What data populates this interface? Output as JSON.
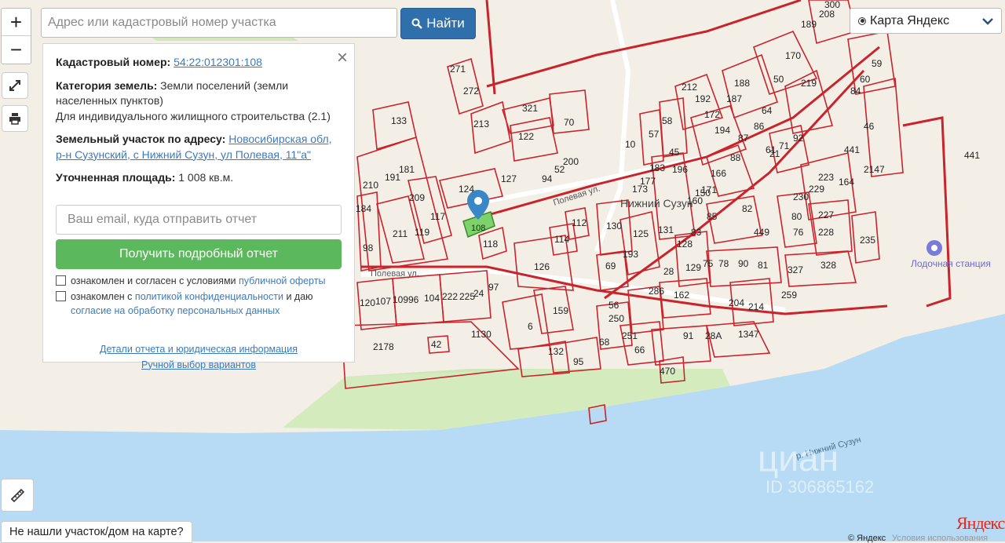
{
  "search": {
    "placeholder": "Адрес или кадастровый номер участка",
    "button_label": "Найти"
  },
  "layer_select": {
    "value": "Карта Яндекс"
  },
  "controls": {
    "zoom_in": "+",
    "zoom_out": "−"
  },
  "panel": {
    "cadastral_label": "Кадастровый номер:",
    "cadastral_number": "54:22:012301:108",
    "category_label": "Категория земель:",
    "category_value": "Земли поселений (земли населенных пунктов)",
    "use_value": "Для индивидуального жилищного строительства (2.1)",
    "address_label": "Земельный участок по адресу:",
    "address_value": "Новосибирская обл, р-н Сузунский, с Нижний Сузун, ул Полевая, 11\"а\"",
    "area_label": "Уточненная площадь:",
    "area_value": "1 008 кв.м.",
    "email_placeholder": "Ваш email, куда отправить отчет",
    "report_button": "Получить подробный отчет",
    "consent1_prefix": "ознакомлен и согласен с условиями",
    "consent1_link": "публичной оферты",
    "consent2_prefix": "ознакомлен с",
    "consent2_link": "политикой конфиденциальности",
    "consent2_mid": "и даю",
    "consent2_link2": "согласие на обработку персональных данных",
    "details_link": "Детали отчета и юридическая информация",
    "manual_link": "Ручной выбор вариантов"
  },
  "bottom": {
    "not_found": "Не нашли участок/дом на карте?",
    "yandex_logo": "Яндекс",
    "copyright": "© Яндекс",
    "terms": "Условия использования"
  },
  "map": {
    "street_1": "Полевая ул.",
    "street_2": "Полевая ул.",
    "village": "Нижний Сузун",
    "station": "Лодочная станция",
    "river": "р. Нижний Сузун",
    "watermark": "циан",
    "watermark_id": "ID 306865162",
    "selected_parcel": "108",
    "parcels": [
      "271",
      "272",
      "213",
      "133",
      "321",
      "122",
      "70",
      "181",
      "191",
      "210",
      "209",
      "124",
      "127",
      "117",
      "119",
      "211",
      "184",
      "98",
      "118",
      "114",
      "112",
      "126",
      "130",
      "125",
      "193",
      "69",
      "131",
      "10",
      "57",
      "58",
      "183",
      "177",
      "173",
      "196",
      "160",
      "150",
      "171",
      "166",
      "212",
      "192",
      "172",
      "194",
      "188",
      "187",
      "50",
      "170",
      "219",
      "189",
      "208",
      "300",
      "59",
      "60",
      "84",
      "46",
      "441",
      "2147",
      "164",
      "223",
      "229",
      "230",
      "80",
      "227",
      "76",
      "228",
      "235",
      "327",
      "328",
      "81",
      "90",
      "78",
      "75",
      "129",
      "128",
      "83",
      "85",
      "82",
      "449",
      "204",
      "214",
      "259",
      "162",
      "286",
      "28",
      "250",
      "251",
      "66",
      "91",
      "28A",
      "1347",
      "56",
      "159",
      "6",
      "132",
      "95",
      "68",
      "470",
      "120",
      "107",
      "109",
      "96",
      "104",
      "222",
      "225",
      "24",
      "97",
      "2178",
      "42",
      "1130",
      "441",
      "45",
      "21",
      "94",
      "52",
      "200",
      "61",
      "71",
      "92",
      "87",
      "88",
      "86",
      "64"
    ]
  }
}
